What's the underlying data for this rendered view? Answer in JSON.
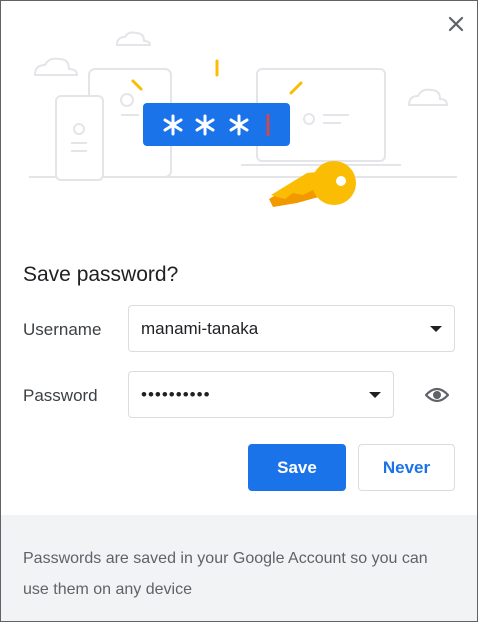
{
  "dialog": {
    "title": "Save password?",
    "close_icon": "close-icon",
    "illustration": {
      "password_mask": "* * *",
      "icons": [
        "cloud-icon",
        "phone-icon",
        "tablet-icon",
        "laptop-icon",
        "key-icon"
      ]
    }
  },
  "form": {
    "username_label": "Username",
    "username_value": "manami-tanaka",
    "password_label": "Password",
    "password_value": "••••••••••",
    "reveal_icon": "eye-icon"
  },
  "buttons": {
    "save_label": "Save",
    "never_label": "Never"
  },
  "footer": {
    "text": "Passwords are saved in your Google Account so you can use them on any device"
  },
  "colors": {
    "primary": "#1a73e8",
    "key": "#fbbc04",
    "key_shadow": "#f29900",
    "footer_bg": "#f1f3f4",
    "cursor_red": "#ea4335"
  }
}
